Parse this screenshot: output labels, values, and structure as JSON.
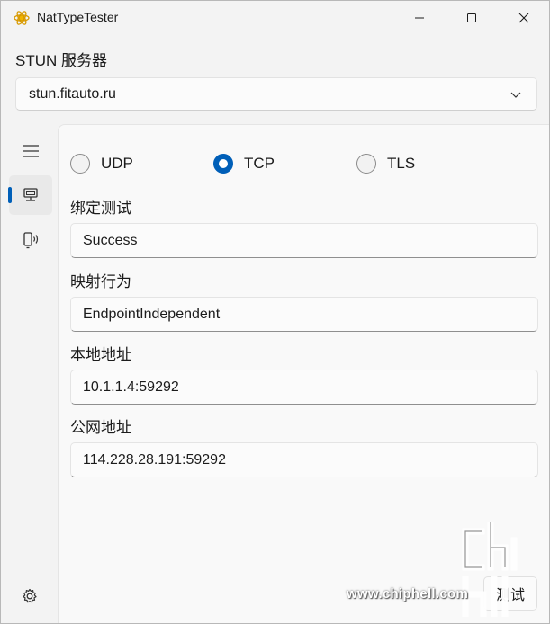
{
  "window": {
    "title": "NatTypeTester",
    "icons": {
      "app": "gear-atom-icon",
      "minimize": "minimize-icon",
      "maximize": "maximize-icon",
      "close": "close-icon"
    }
  },
  "stun": {
    "label": "STUN 服务器",
    "server": "stun.fitauto.ru"
  },
  "nav": {
    "items": [
      {
        "icon": "hamburger-menu-icon"
      },
      {
        "icon": "monitor-icon",
        "active": true
      },
      {
        "icon": "device-broadcast-icon"
      }
    ],
    "settings_icon": "gear-icon",
    "accent": "#005fb8"
  },
  "protocols": {
    "options": [
      "UDP",
      "TCP",
      "TLS"
    ],
    "selected": "TCP"
  },
  "fields": {
    "binding_label": "绑定测试",
    "binding_value": "Success",
    "mapping_label": "映射行为",
    "mapping_value": "EndpointIndependent",
    "local_label": "本地地址",
    "local_value": "10.1.1.4:59292",
    "public_label": "公网地址",
    "public_value": "114.228.28.191:59292"
  },
  "actions": {
    "test_label": "测试"
  },
  "watermark": {
    "url": "www.chiphell.com"
  }
}
